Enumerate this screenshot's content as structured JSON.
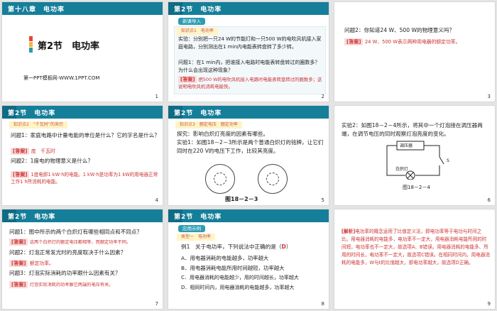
{
  "s1": {
    "chapter": "第十八章　电功率",
    "section": "第2节　电功率",
    "footer": "第一PPT模板网-WWW.1PPT.COM",
    "num": "1"
  },
  "s2": {
    "hdr": "第2节　电功率",
    "tag": "新课导入",
    "sub": "知识点1　电功率",
    "exp": "实验：分别把一只24 W的节能灯和一只500 W的电吹风机接入家庭电路，分别测出在1 min内电能表转盘转了多少转。",
    "q1": "问题1：在1 min内，把谁接入电路时电能表转盘转过的圈数多？为什么会出现这种现象？",
    "ans_label": "[答案]",
    "ans": "把500 W的电吹风机接入电路时电能表转盘转过的圈数多；这说明电吹风机消耗电能快。",
    "num": "2"
  },
  "s3": {
    "q2": "问题2：你知道24 W、500 W的物理意义吗？",
    "ans_label": "[答案]",
    "ans": "24 W、500 W表示两种用电器的额定功率。",
    "num": "3"
  },
  "s4": {
    "hdr": "第2节　电功率",
    "tag": "知识点2　“千瓦时”的来历",
    "q1": "问题1：家庭电路中计量电能的单位是什么？它的字名是什么？",
    "a1_label": "[答案]",
    "a1": "度　千瓦时",
    "q2": "问题2：1度电的物理意义是什么？",
    "a2_label": "[答案]",
    "a2": "1度电即1 kW·h的电能。1 kW·h是功率为1 kW的用电器正常工作1 h所消耗的电能。",
    "num": "4"
  },
  "s5": {
    "hdr": "第2节　电功率",
    "tag": "知识点3　额定电压　额定功率",
    "exp": "探究：影响白炽灯亮度的因素有哪些。",
    "exp2": "实验1：如图18－2－3所示是两个普通白炽灯的铭牌，让它们同时在220 V的电压下工作，比较其亮度。",
    "fig": "图18－2－3",
    "num": "5"
  },
  "s6": {
    "text": "实验2：如图18－2－4所示，将其中一个灯泡接在调压器两端，在调节电压的同时观察灯泡亮度的变化。",
    "box": "调压器",
    "lamp": "白炽灯",
    "switch": "S",
    "fig": "图18－2－4",
    "num": "6"
  },
  "s7": {
    "hdr": "第2节　电功率",
    "q1": "问题1：图中所示的两个白炽灯有哪些相同点和不同点？",
    "a1_label": "[答案]",
    "a1": "这两个白炽灯的额定电压都相等，而额定功率不同。",
    "q2": "问题2：灯泡正常发光时的亮度取决于什么因素？",
    "a2_label": "[答案]",
    "a2": "额定功率。",
    "q3": "问题3：灯泡实际消耗的功率跟什么因素有关？",
    "a3_label": "[答案]",
    "a3": "灯泡实际消耗的功率跟它两端的电压有关。",
    "num": "7"
  },
  "s8": {
    "hdr": "第2节　电功率",
    "tag": "应用示例",
    "sub": "类型一　电功率",
    "q": "例1　关于电功率，下列说法中正确的是（",
    "ans": "D",
    "qend": "）",
    "opts": [
      "A．用电器消耗的电能越多，功率越大",
      "B．用电器消耗电能所用时间越短，功率越大",
      "C．用电器消耗的电能越少，用的时间越长，功率越大",
      "D．相同时间内，用电器消耗的电能越多，功率越大"
    ],
    "num": "8"
  },
  "s9": {
    "label": "[解析]",
    "text": "电功率的概念运用了比值定义法，即电功率等于电功与时间之比。用电器消耗的电能多，电功率不一定大，用电器消耗电能所用的时间短，电功率也不一定大，故选项A、B错误。用电器消耗的电能多、所用的时间长，电功率不一定大，故选项C错误。在相同时间内，用电器消耗的电能多，W与t的比值越大，即电功率越大，故选项D正确。",
    "num": "9"
  },
  "colors": {
    "header": "#157f9a",
    "answer": "#c33"
  }
}
